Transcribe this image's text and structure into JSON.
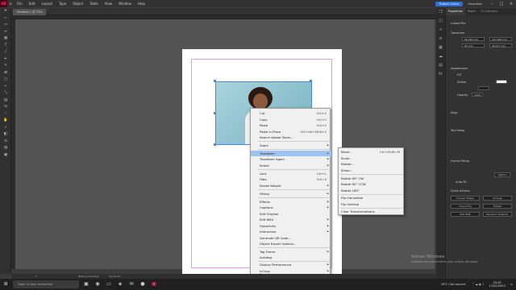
{
  "menu": {
    "app_logo": "Id",
    "items": [
      "File",
      "Edit",
      "Layout",
      "Type",
      "Object",
      "Table",
      "View",
      "Window",
      "Help"
    ],
    "publish": "Publish Online",
    "workspace": "Essentials"
  },
  "document_tab": "*Untitled-1 @ 75%",
  "context_menu": [
    {
      "label": "Cut",
      "shortcut": "Ctrl+X"
    },
    {
      "label": "Copy",
      "shortcut": "Ctrl+C"
    },
    {
      "label": "Paste",
      "shortcut": "Ctrl+V"
    },
    {
      "label": "Paste in Place",
      "shortcut": "Ctrl+Alt+Shift+V"
    },
    {
      "label": "Search Adobe Stock..."
    },
    {
      "label": "Zoom",
      "submenu": true
    },
    {
      "label": "Transform",
      "submenu": true,
      "highlighted": true
    },
    {
      "label": "Transform Again",
      "submenu": true
    },
    {
      "label": "Select",
      "submenu": true
    },
    {
      "label": "Lock",
      "shortcut": "Ctrl+L"
    },
    {
      "label": "Hide",
      "shortcut": "Ctrl+3"
    },
    {
      "label": "Stroke Weight",
      "submenu": true
    },
    {
      "label": "Fitting",
      "submenu": true
    },
    {
      "label": "Effects",
      "submenu": true
    },
    {
      "label": "Captions",
      "submenu": true
    },
    {
      "label": "Edit Original"
    },
    {
      "label": "Edit With",
      "submenu": true
    },
    {
      "label": "Hyperlinks",
      "submenu": true
    },
    {
      "label": "Interactive",
      "submenu": true
    },
    {
      "label": "Generate QR Code..."
    },
    {
      "label": "Object Export Options..."
    },
    {
      "label": "Tag Frame",
      "submenu": true
    },
    {
      "label": "Autotag"
    },
    {
      "label": "Display Performance",
      "submenu": true
    },
    {
      "label": "InCopy",
      "submenu": true
    },
    {
      "label": "Graphics",
      "submenu": true
    }
  ],
  "transform_submenu": [
    {
      "label": "Move...",
      "shortcut": "Ctrl+Shift+M"
    },
    {
      "label": "Scale..."
    },
    {
      "label": "Rotate..."
    },
    {
      "label": "Shear..."
    },
    {
      "label": "Rotate 90° CW"
    },
    {
      "label": "Rotate 90° CCW"
    },
    {
      "label": "Rotate 180°"
    },
    {
      "label": "Flip Horizontal"
    },
    {
      "label": "Flip Vertical"
    },
    {
      "label": "Clear Transformations"
    }
  ],
  "panel": {
    "tabs": [
      "Properties",
      "Pages",
      "CC Libraries"
    ],
    "linked_file": "Linked File",
    "transform": "Transform",
    "w": "96,189 mm",
    "x": "121,600 mm",
    "h": "60 mm",
    "y": "56,077 mm",
    "appearance": "Appearance",
    "fill": "Fill",
    "stroke": "Stroke",
    "opacity": "Opacity",
    "opacity_val": "100%",
    "align": "Align",
    "text_wrap": "Text Wrap",
    "frame_fitting": "Frame Fitting",
    "options": "Options",
    "auto_fit": "Auto-Fit",
    "quick_actions": "Quick Actions",
    "actions": [
      "Convert Shape",
      "Arrange",
      "Import File",
      "Embed",
      "Edit With",
      "Reveal in Explorer"
    ]
  },
  "status": {
    "page": "1",
    "preflight": "[Basic] (working)",
    "errors": "No errors"
  },
  "watermark": {
    "title": "Activer Windows",
    "subtitle": "Accédez aux paramètres pour activer Windows."
  },
  "taskbar": {
    "search_placeholder": "Taper ici pour rechercher",
    "weather": "16°C Ciel couvert",
    "time": "20:43",
    "date": "17/02/2023"
  }
}
